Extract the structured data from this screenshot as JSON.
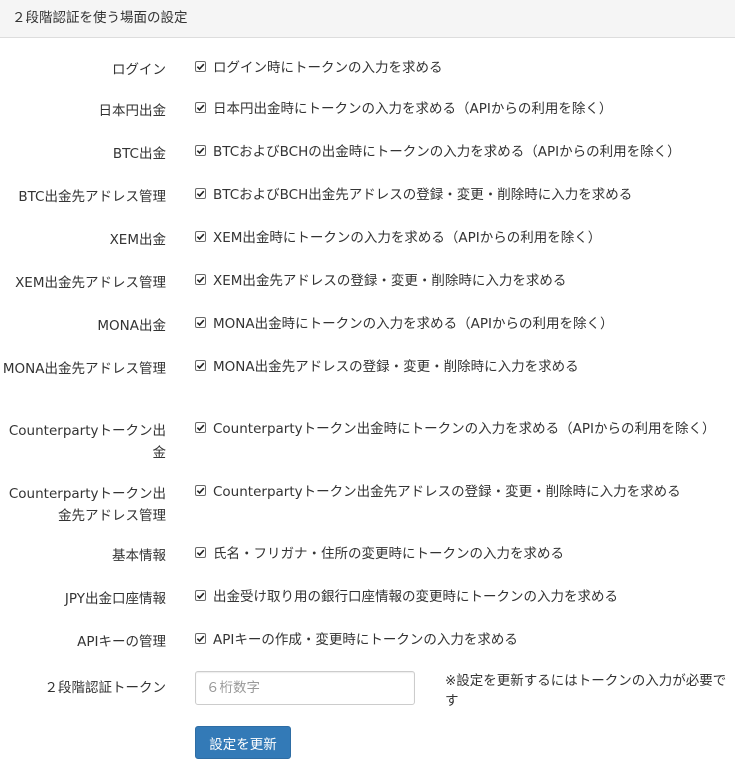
{
  "panel": {
    "title": "２段階認証を使う場面の設定"
  },
  "settings": [
    {
      "label": "ログイン",
      "text": "ログイン時にトークンの入力を求める",
      "checked": true
    },
    {
      "label": "日本円出金",
      "text": "日本円出金時にトークンの入力を求める（APIからの利用を除く）",
      "checked": true
    },
    {
      "label": "BTC出金",
      "text": "BTCおよびBCHの出金時にトークンの入力を求める（APIからの利用を除く）",
      "checked": true
    },
    {
      "label": "BTC出金先アドレス管理",
      "text": "BTCおよびBCH出金先アドレスの登録・変更・削除時に入力を求める",
      "checked": true
    },
    {
      "label": "XEM出金",
      "text": "XEM出金時にトークンの入力を求める（APIからの利用を除く）",
      "checked": true
    },
    {
      "label": "XEM出金先アドレス管理",
      "text": "XEM出金先アドレスの登録・変更・削除時に入力を求める",
      "checked": true
    },
    {
      "label": "MONA出金",
      "text": "MONA出金時にトークンの入力を求める（APIからの利用を除く）",
      "checked": true
    },
    {
      "label": "MONA出金先アドレス管理",
      "text": "MONA出金先アドレスの登録・変更・削除時に入力を求める",
      "checked": true
    },
    {
      "label": "Counterpartyトークン出金",
      "text": "Counterpartyトークン出金時にトークンの入力を求める（APIからの利用を除く）",
      "checked": true
    },
    {
      "label": "Counterpartyトークン出金先アドレス管理",
      "text": "Counterpartyトークン出金先アドレスの登録・変更・削除時に入力を求める",
      "checked": true
    },
    {
      "label": "基本情報",
      "text": "氏名・フリガナ・住所の変更時にトークンの入力を求める",
      "checked": true
    },
    {
      "label": "JPY出金口座情報",
      "text": "出金受け取り用の銀行口座情報の変更時にトークンの入力を求める",
      "checked": true
    },
    {
      "label": "APIキーの管理",
      "text": "APIキーの作成・変更時にトークンの入力を求める",
      "checked": true
    }
  ],
  "token": {
    "label": "２段階認証トークン",
    "value": "",
    "placeholder": "６桁数字",
    "note": "※設定を更新するにはトークンの入力が必要です"
  },
  "submit": {
    "label": "設定を更新"
  },
  "colors": {
    "primary_button": "#337ab7",
    "heading_background": "#f5f5f5"
  }
}
